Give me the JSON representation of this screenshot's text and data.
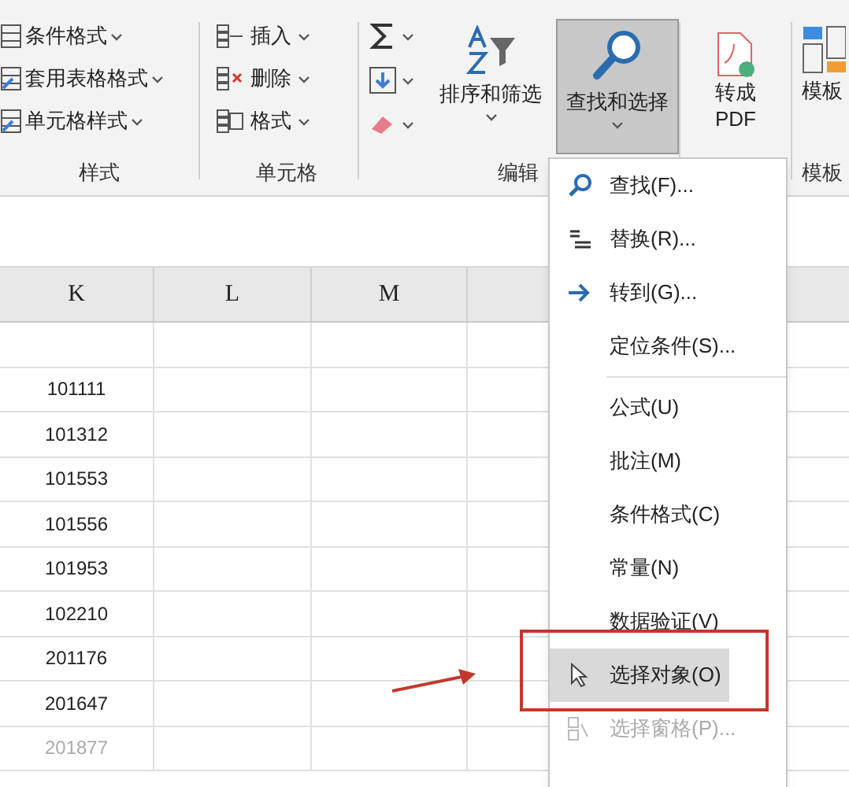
{
  "ribbon": {
    "styles_group": {
      "label": "样式",
      "items": [
        {
          "label": "条件格式",
          "kind": "conditional"
        },
        {
          "label": "套用表格格式",
          "kind": "table"
        },
        {
          "label": "单元格样式",
          "kind": "cellstyle"
        }
      ]
    },
    "cells_group": {
      "label": "单元格",
      "items": [
        {
          "label": "插入",
          "kind": "insert"
        },
        {
          "label": "删除",
          "kind": "delete"
        },
        {
          "label": "格式",
          "kind": "format"
        }
      ]
    },
    "editing_group": {
      "label": "编辑",
      "small_buttons": [
        {
          "kind": "sum"
        },
        {
          "kind": "fill"
        },
        {
          "kind": "clear"
        }
      ],
      "large_buttons": [
        {
          "label": "排序和筛选",
          "kind": "sort",
          "selected": false
        },
        {
          "label": "查找和选择",
          "kind": "find",
          "selected": true
        }
      ]
    },
    "pdf_group": {
      "label_lines": [
        "转成",
        "PDF"
      ]
    },
    "template_group": {
      "button": "模板",
      "label": "模板"
    }
  },
  "sheet": {
    "columns": [
      "K",
      "L",
      "M"
    ],
    "rows": [
      {
        "value": "101111",
        "muted": false
      },
      {
        "value": "101312",
        "muted": false
      },
      {
        "value": "101553",
        "muted": false
      },
      {
        "value": "101556",
        "muted": false
      },
      {
        "value": "101953",
        "muted": false
      },
      {
        "value": "102210",
        "muted": false
      },
      {
        "value": "201176",
        "muted": false
      },
      {
        "value": "201647",
        "muted": false
      },
      {
        "value": "201877",
        "muted": true
      }
    ]
  },
  "menu": {
    "sections": [
      [
        {
          "label": "查找(F)...",
          "kind": "find",
          "selected": false,
          "disabled": false
        },
        {
          "label": "替换(R)...",
          "kind": "replace",
          "selected": false,
          "disabled": false
        },
        {
          "label": "转到(G)...",
          "kind": "goto",
          "selected": false,
          "disabled": false
        },
        {
          "label": "定位条件(S)...",
          "kind": "plain",
          "selected": false,
          "disabled": false
        }
      ],
      [
        {
          "label": "公式(U)",
          "kind": "plain",
          "selected": false,
          "disabled": false
        },
        {
          "label": "批注(M)",
          "kind": "plain",
          "selected": false,
          "disabled": false
        },
        {
          "label": "条件格式(C)",
          "kind": "plain",
          "selected": false,
          "disabled": false
        },
        {
          "label": "常量(N)",
          "kind": "plain",
          "selected": false,
          "disabled": false
        },
        {
          "label": "数据验证(V)",
          "kind": "plain",
          "selected": false,
          "disabled": false
        },
        {
          "label": "选择对象(O)",
          "kind": "pointer",
          "selected": true,
          "disabled": false
        },
        {
          "label": "选择窗格(P)...",
          "kind": "pane",
          "selected": false,
          "disabled": true
        }
      ]
    ]
  }
}
